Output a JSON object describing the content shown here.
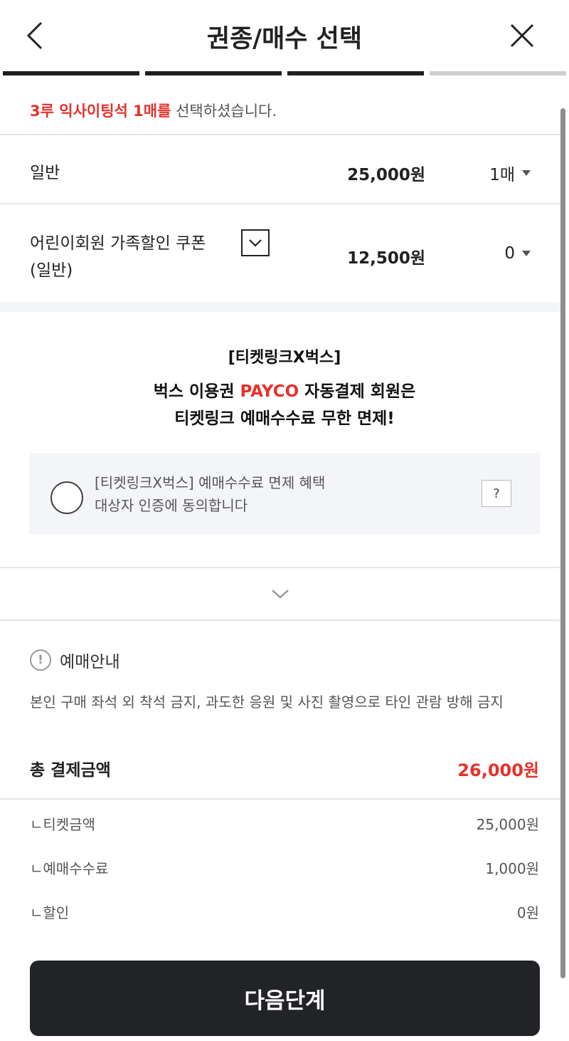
{
  "header": {
    "title": "권종/매수 선택",
    "steps": [
      "active",
      "active",
      "active",
      "inactive"
    ]
  },
  "selection": {
    "highlight": "3루 익사이팅석 1매를",
    "suffix": "선택하셨습니다."
  },
  "tickets": [
    {
      "name": "일반",
      "price": "25,000원",
      "qty": "1매"
    },
    {
      "name_line1": "어린이회원 가족할인 쿠폰",
      "name_line2": "(일반)",
      "price": "12,500원",
      "qty": "0"
    }
  ],
  "promo": {
    "line1": "[티켓링크X벅스]",
    "line2_prefix": "벅스 이용권",
    "line2_brand": "PAYCO",
    "line2_suffix": "자동결제 회원은",
    "line3": "티켓링크 예매수수료 무한 면제!",
    "consent_line1": "[티켓링크X벅스] 예매수수료 면제 혜택",
    "consent_line2": "대상자 인증에 동의합니다",
    "help": "?"
  },
  "notice": {
    "icon": "!",
    "title": "예매안내",
    "body": "본인 구매 좌석 외 착석 금지, 과도한 응원 및 사진 촬영으로 타인 관람 방해 금지"
  },
  "summary": {
    "total_label": "총 결제금액",
    "total_value": "26,000원",
    "items": [
      {
        "label": "ㄴ티켓금액",
        "value": "25,000원"
      },
      {
        "label": "ㄴ예매수수료",
        "value": "1,000원"
      },
      {
        "label": "ㄴ할인",
        "value": "0원"
      }
    ]
  },
  "next_button": "다음단계",
  "colors": {
    "accent": "#e5322d",
    "button": "#222326",
    "band": "#f4f5f8"
  }
}
